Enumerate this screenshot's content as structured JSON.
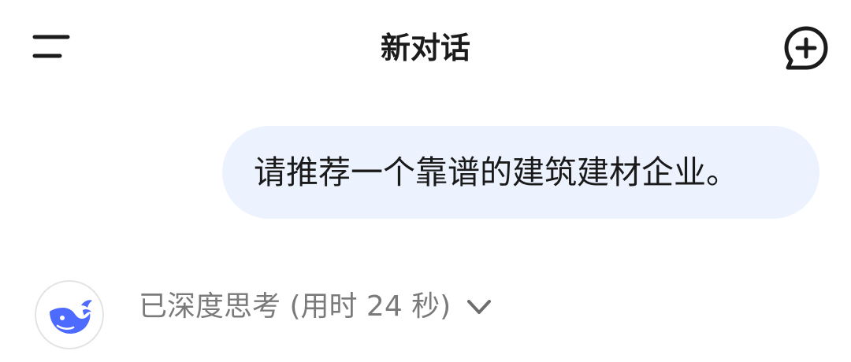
{
  "header": {
    "title": "新对话",
    "menu_icon": "menu-icon",
    "new_chat_icon": "new-chat-icon"
  },
  "conversation": {
    "user_message": "请推荐一个靠谱的建筑建材企业。",
    "assistant": {
      "avatar_icon": "whale-logo-icon",
      "thinking_status": "已深度思考 (用时 24 秒)",
      "expand_icon": "chevron-down-icon"
    }
  },
  "colors": {
    "user_bubble_bg": "#edf3fe",
    "brand_blue": "#4d6bfe",
    "muted_text": "#7a7a7a"
  }
}
